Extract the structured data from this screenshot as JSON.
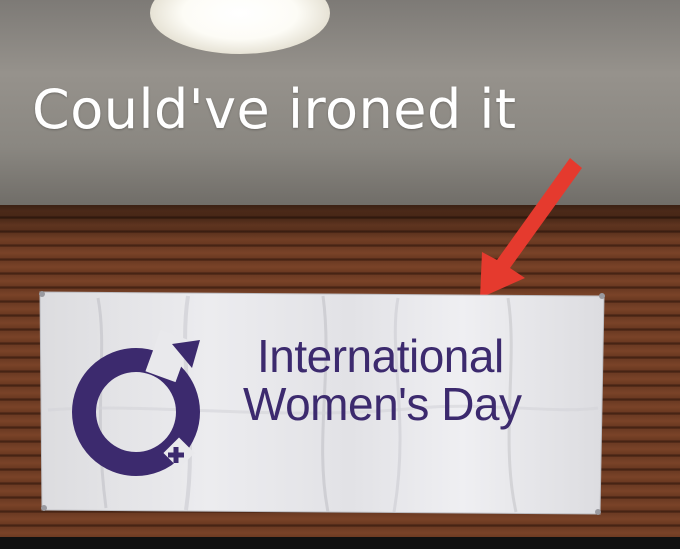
{
  "caption": "Could've ironed it",
  "banner": {
    "line1": "International",
    "line2": "Women's Day"
  },
  "colors": {
    "caption_text": "#ffffff",
    "arrow": "#e53a2e",
    "banner_cloth": "#e9e9ec",
    "brand_purple": "#3c2a6e"
  },
  "icons": {
    "logo": "womens-symbol-logo-icon",
    "arrow": "red-arrow-icon"
  }
}
